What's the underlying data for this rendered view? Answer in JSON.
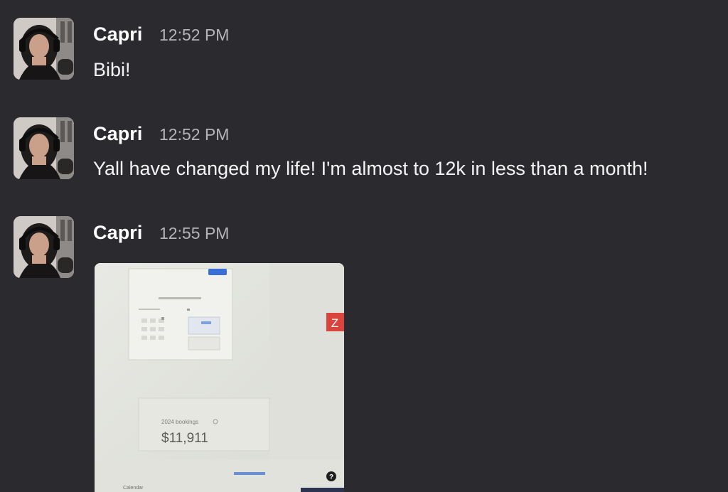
{
  "messages": [
    {
      "author": "Capri",
      "time": "12:52 PM",
      "text": "Bibi!"
    },
    {
      "author": "Capri",
      "time": "12:52 PM",
      "text": "Yall have changed my life! I'm almost to 12k in less than a month!"
    },
    {
      "author": "Capri",
      "time": "12:55 PM",
      "text": ""
    }
  ],
  "attachment": {
    "amount": "$11,911",
    "caption": "2024 bookings",
    "footer_label": "Calendar",
    "badge_letter": "Z"
  },
  "colors": {
    "background": "#2b2a2f",
    "name": "#ffffff",
    "timestamp": "#b5b4b9",
    "message_text": "#f3f3f4",
    "badge": "#d9443f",
    "button": "#3b6fd8"
  },
  "icons": {
    "avatar": "user-avatar-photo"
  }
}
